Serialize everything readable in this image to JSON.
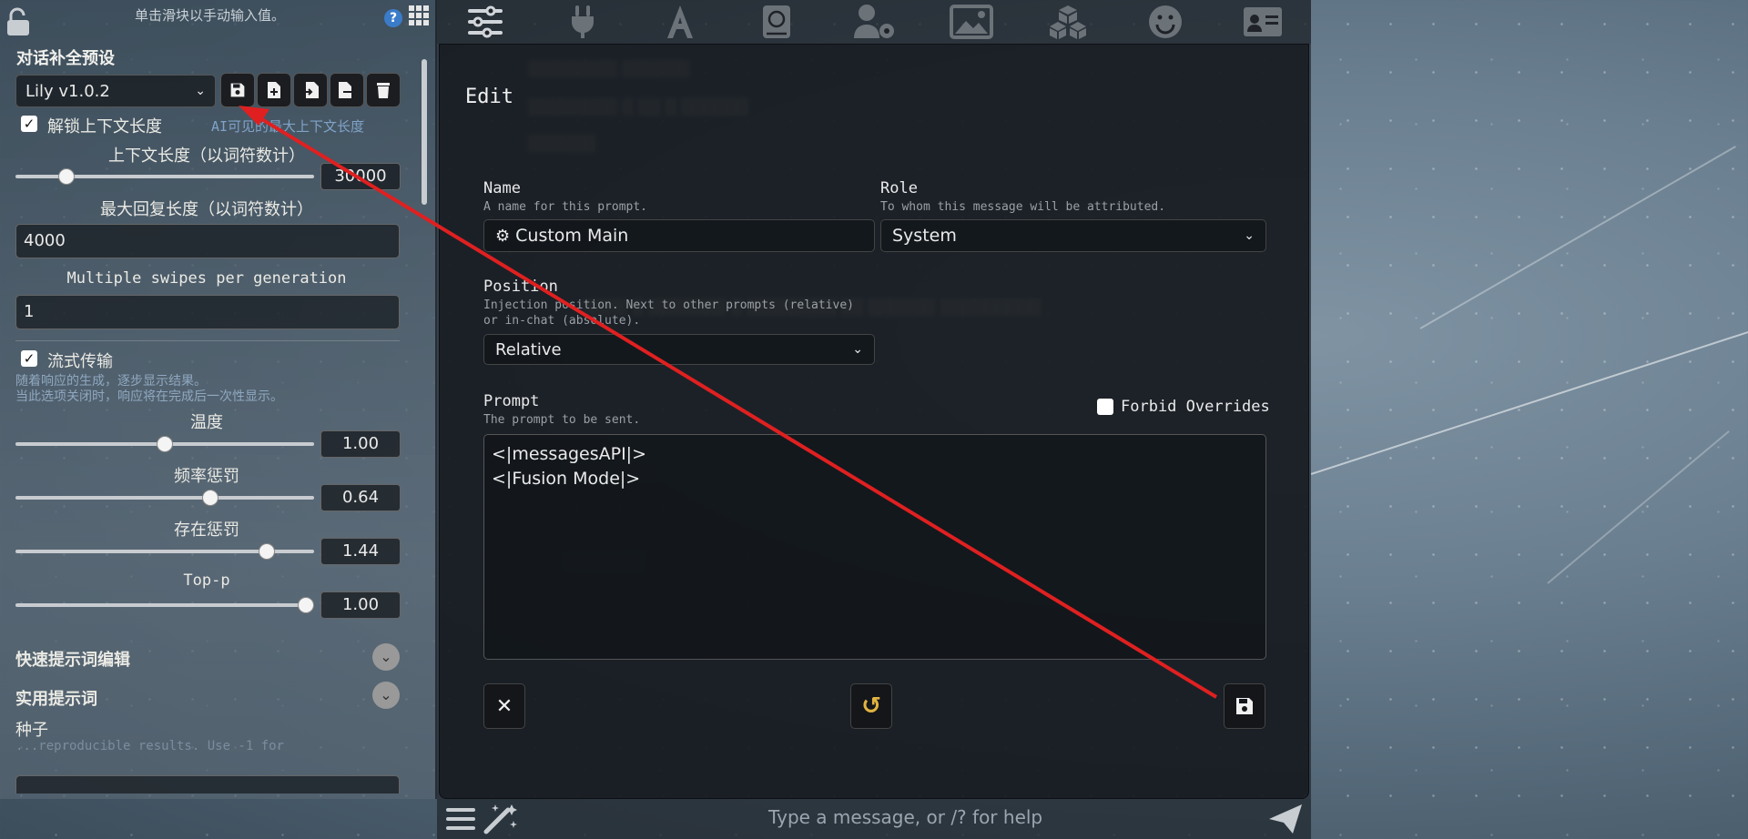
{
  "topbar": {
    "icons": [
      "sliders-icon",
      "plug-icon",
      "font-icon",
      "book-atlas-icon",
      "user-gear-icon",
      "image-icon",
      "cubes-icon",
      "smiley-icon",
      "id-card-icon"
    ]
  },
  "left_panel": {
    "hint": "单击滑块以手动输入值。",
    "help": "?",
    "section_title": "对话补全预设",
    "preset_select": "Lily v1.0.2",
    "unlock_context_label": "解锁上下文长度",
    "unlock_context_note": "AI可见的最大上下文长度",
    "context_length_label": "上下文长度（以词符数计）",
    "context_length_value": "30000",
    "context_length_fraction": 0.15,
    "max_reply_label": "最大回复长度（以词符数计）",
    "max_reply_value": "4000",
    "swipes_label": "Multiple swipes per generation",
    "swipes_value": "1",
    "streaming_label": "流式传输",
    "streaming_note_1": "随着响应的生成，逐步显示结果。",
    "streaming_note_2": "当此选项关闭时，响应将在完成后一次性显示。",
    "temperature": {
      "label": "温度",
      "value": "1.00",
      "fraction": 0.5
    },
    "freq_penalty": {
      "label": "频率惩罚",
      "value": "0.64",
      "fraction": 0.66
    },
    "presence_penalty": {
      "label": "存在惩罚",
      "value": "1.44",
      "fraction": 0.86
    },
    "top_p": {
      "label": "Top-p",
      "value": "1.00",
      "fraction": 1.0
    },
    "quick_prompt_label": "快速提示词编辑",
    "utility_prompt_label": "实用提示词",
    "seed_label": "种子",
    "seed_note": "...reproducible results. Use -1 for"
  },
  "modal": {
    "title": "Edit",
    "name_label": "Name",
    "name_sub": "A name for this prompt.",
    "name_value": "Custom Main",
    "role_label": "Role",
    "role_sub": "To whom this message will be attributed.",
    "role_value": "System",
    "position_label": "Position",
    "position_sub_1": "Injection position. Next to other prompts (relative)",
    "position_sub_2": "or in-chat (absolute).",
    "position_value": "Relative",
    "prompt_label": "Prompt",
    "prompt_sub": "The prompt to be sent.",
    "forbid_overrides": "Forbid Overrides",
    "prompt_line_1": "<|messagesAPI|>",
    "prompt_line_2": "<|Fusion Mode|>"
  },
  "bottom": {
    "placeholder": "Type a message, or /? for help"
  },
  "colors": {
    "accent_red": "#e02020",
    "reset_icon": "#e3b341"
  }
}
